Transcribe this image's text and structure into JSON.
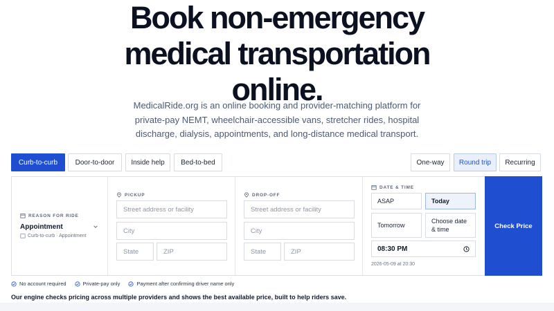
{
  "hero": {
    "title_line1": "Book non-emergency",
    "title_line2": "medical transportation",
    "title_line3": "online.",
    "subtitle": "MedicalRide.org is an online booking and provider-matching platform for private-pay NEMT, wheelchair-accessible vans, stretcher rides, hospital discharge, dialysis, appointments, and long-distance medical transport."
  },
  "service_tabs": [
    "Curb-to-curb",
    "Door-to-door",
    "Inside help",
    "Bed-to-bed"
  ],
  "trip_tabs": [
    "One-way",
    "Round trip",
    "Recurring"
  ],
  "form": {
    "reason_label": "REASON FOR RIDE",
    "reason_value": "Appointment",
    "reason_sub": "Curb-to-curb · Appointment",
    "pickup_label": "PICKUP",
    "pickup_street_placeholder": "Street address or facility",
    "pickup_city_placeholder": "City",
    "pickup_state_placeholder": "State",
    "pickup_zip_placeholder": "ZIP",
    "dropoff_label": "DROP-OFF",
    "dropoff_street_placeholder": "Street address or facility",
    "dropoff_city_placeholder": "City",
    "dropoff_state_placeholder": "State",
    "dropoff_zip_placeholder": "ZIP",
    "datetime_label": "DATE & TIME",
    "asap": "ASAP",
    "today": "Today",
    "tomorrow": "Tomorrow",
    "choose_line1": "Choose date",
    "choose_line2": "& time",
    "time_value": "08:30 PM",
    "datetime_stamp": "2026-05-09 at 20:30",
    "check_price": "Check Price"
  },
  "perks": [
    "No account required",
    "Private-pay only",
    "Payment after confirming driver name only"
  ],
  "footer_note": "Our engine checks pricing across multiple providers and shows the best available price, built to help riders save.",
  "colors": {
    "accent": "#1f4fd0",
    "title": "#0b1120",
    "muted": "#4b5a70"
  }
}
